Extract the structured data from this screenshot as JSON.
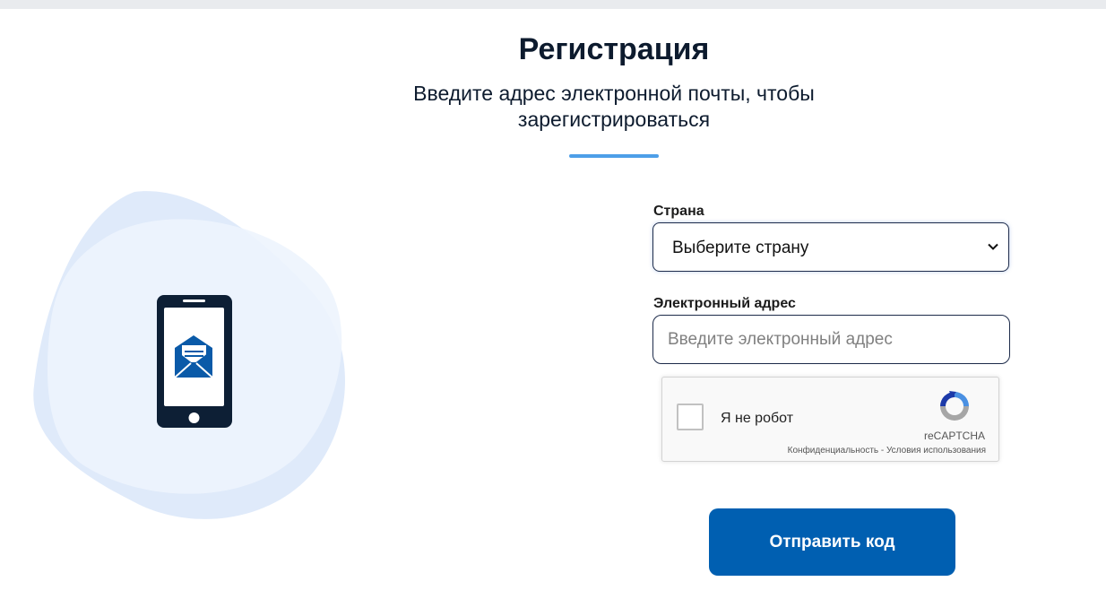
{
  "page": {
    "title": "Регистрация",
    "subtitle_line1": "Введите адрес электронной почты, чтобы",
    "subtitle_line2": "зарегистрироваться"
  },
  "form": {
    "country_label": "Страна",
    "country_selected": "Выберите страну",
    "email_label": "Электронный адрес",
    "email_placeholder": "Введите электронный адрес",
    "email_value": "",
    "submit_label": "Отправить код"
  },
  "captcha": {
    "label": "Я не робот",
    "brand": "reCAPTCHA",
    "privacy_link": "Конфиденциальность",
    "separator": " - ",
    "terms_link": "Условия использования",
    "checked": false
  },
  "illustration": {
    "icons": [
      "smartphone-icon",
      "envelope-icon"
    ]
  },
  "colors": {
    "title": "#0d1b2e",
    "accent_divider": "#4d9fe8",
    "primary_button": "#005fb1",
    "phone_body": "#0d1f35",
    "envelope": "#0a5aa8",
    "blob_light": "#eaf2fc",
    "blob_mid": "#dde9f9"
  }
}
